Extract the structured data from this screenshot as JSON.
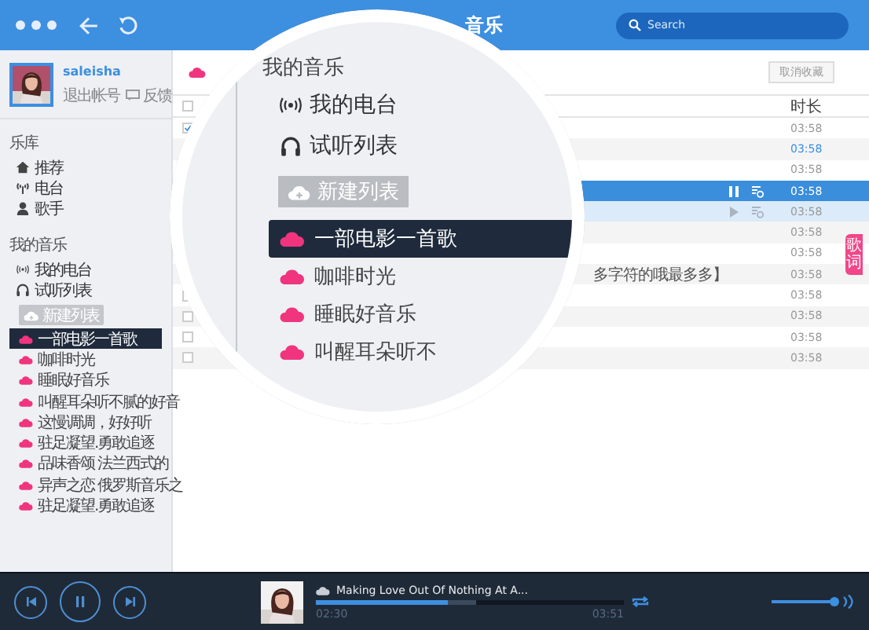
{
  "window": {
    "title": "音乐"
  },
  "search": {
    "placeholder": "Search"
  },
  "profile": {
    "username": "saleisha",
    "logout": "退出帐号",
    "feedback": "反馈"
  },
  "sidebar": {
    "library": {
      "heading": "乐库",
      "items": [
        {
          "label": "推荐",
          "kind": "home"
        },
        {
          "label": "电台",
          "kind": "signal"
        },
        {
          "label": "歌手",
          "kind": "person"
        }
      ]
    },
    "my_music": {
      "heading": "我的音乐",
      "items": [
        {
          "label": "我的电台",
          "kind": "radio"
        },
        {
          "label": "试听列表",
          "kind": "headphones"
        }
      ],
      "new_list_button": "新建列表",
      "playlists": [
        {
          "label": "一部电影一首歌",
          "selected": true
        },
        {
          "label": "咖啡时光",
          "selected": false
        },
        {
          "label": "睡眠好音乐",
          "selected": false
        },
        {
          "label": "叫醒耳朵听不腻的好音",
          "selected": false
        },
        {
          "label": "这慢调调，好好听",
          "selected": false
        },
        {
          "label": "驻足凝望.勇敢追逐",
          "selected": false
        },
        {
          "label": "品味香颂 法兰西式的",
          "selected": false
        },
        {
          "label": "异声之恋 俄罗斯音乐之",
          "selected": false
        },
        {
          "label": "驻足凝望.勇敢追逐",
          "selected": false
        }
      ]
    }
  },
  "main": {
    "unfavorite_button": "取消收藏",
    "table": {
      "columns": [
        "时长"
      ],
      "header_checked": false,
      "rows": [
        {
          "checked": true,
          "selected": false,
          "duration": "03:58"
        },
        {
          "selected": false,
          "highlighted": true,
          "duration": "03:58"
        },
        {
          "selected": false,
          "duration": "03:58"
        },
        {
          "selected": true,
          "duration": "03:58"
        },
        {
          "selected": false,
          "hovered": true,
          "duration": "03:58"
        },
        {
          "selected": false,
          "duration": "03:58"
        },
        {
          "selected": false,
          "duration": "03:58"
        },
        {
          "selected": false,
          "title": "多字符的哦最多多】",
          "duration": "03:58"
        },
        {
          "checked": false,
          "selected": false,
          "duration": "03:58"
        },
        {
          "checked": false,
          "selected": false,
          "duration": "03:58"
        },
        {
          "checked": false,
          "selected": false,
          "duration": "03:58"
        },
        {
          "checked": false,
          "selected": false,
          "duration": "03:58"
        }
      ]
    },
    "lyrics_tab": "歌词"
  },
  "magnifier": {
    "heading": "我的音乐",
    "items": [
      {
        "label": "我的电台",
        "kind": "radio"
      },
      {
        "label": "试听列表",
        "kind": "headphones"
      }
    ],
    "new_list_button": "新建列表",
    "playlists": [
      {
        "label": "一部电影一首歌",
        "selected": true
      },
      {
        "label": "咖啡时光",
        "selected": false
      },
      {
        "label": "睡眠好音乐",
        "selected": false
      },
      {
        "label": "叫醒耳朵听不",
        "selected": false
      }
    ]
  },
  "player": {
    "playing": true,
    "title": "Making Love Out Of Nothing At A...",
    "progress": {
      "level": 0.43
    },
    "elapsed": "02:30",
    "total": "03:51",
    "volume": {
      "level": 0.95
    }
  }
}
